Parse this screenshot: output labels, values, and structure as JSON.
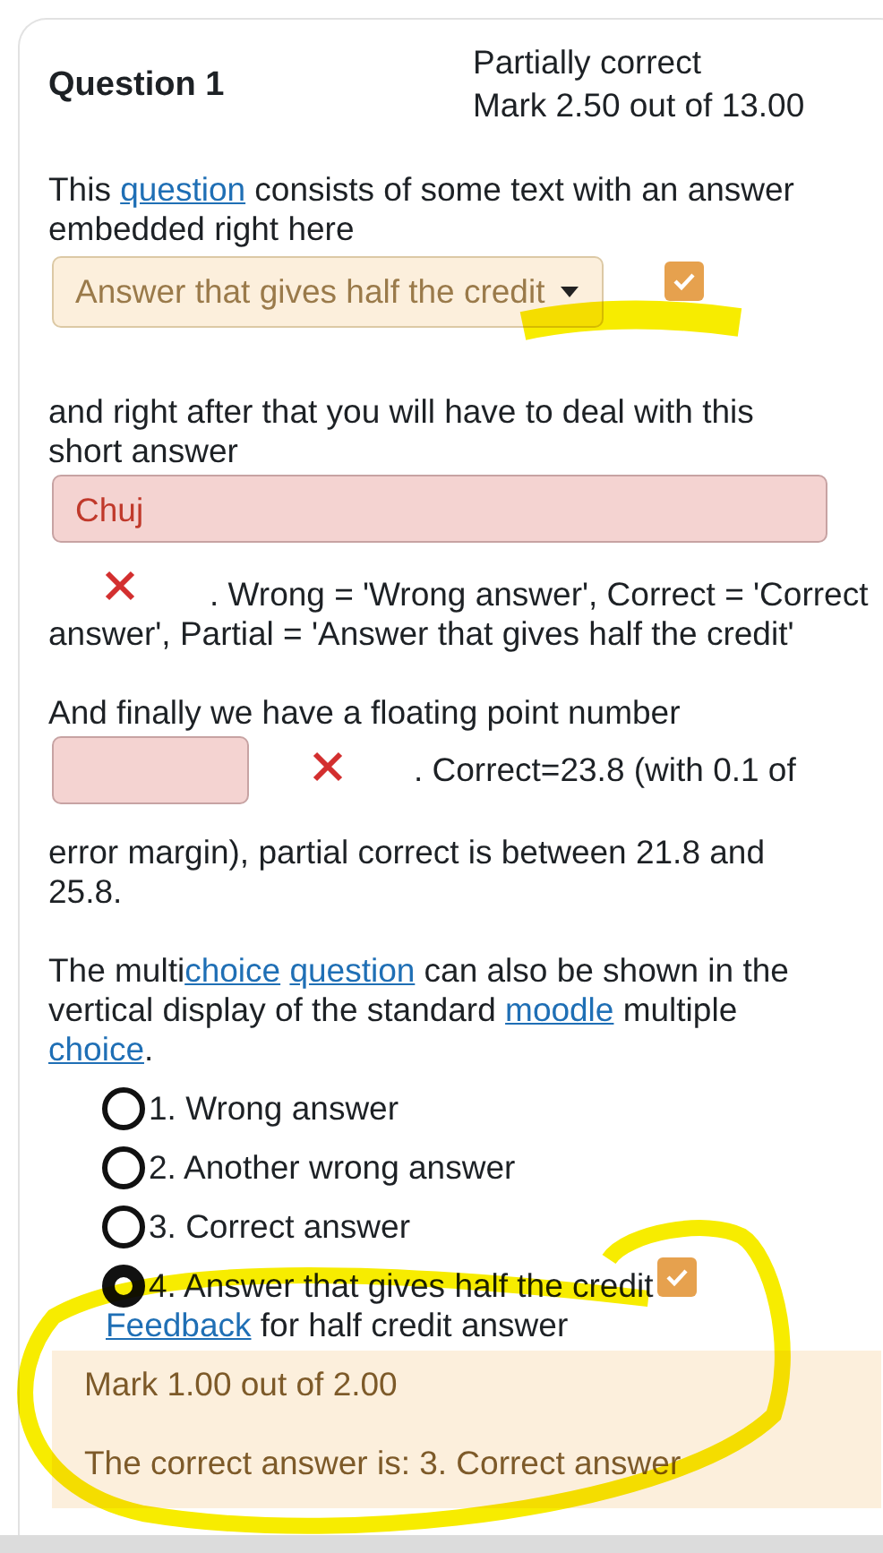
{
  "question": {
    "title": "Question 1",
    "state": "Partially correct",
    "mark": "Mark 2.50 out of 13.00"
  },
  "intro": [
    {
      "kind": "text",
      "text": "This "
    },
    {
      "kind": "link",
      "text": "question"
    },
    {
      "kind": "text",
      "text": " consists of some text with an answer embedded right here"
    }
  ],
  "dropdown": {
    "value": "Answer that gives half the credit",
    "partially_correct": true
  },
  "short_intro": "and right after that you will have to deal with this short answer",
  "short_answer": {
    "value": "Chuj",
    "partially_correct": false
  },
  "short_feedback": [
    ". Wrong = 'Wrong answer', Correct = 'Correct",
    "answer', Partial = 'Answer that gives half the credit'"
  ],
  "numeric_intro": "And finally we have a floating point number",
  "numeric": {
    "partially_correct": false
  },
  "numeric_feedback": [
    ". Correct=23.8 (with 0.1 of",
    "error margin), partial correct is between 21.8 and 25.8."
  ],
  "mc_intro": [
    {
      "kind": "text",
      "text": "The multi"
    },
    {
      "kind": "link",
      "text": "choice"
    },
    {
      "kind": "link",
      "text": "question"
    },
    {
      "kind": "text",
      "text": " can also be shown in the vertical display of the standard "
    },
    {
      "kind": "link",
      "text": "moodle"
    },
    {
      "kind": "text",
      "text": " multiple "
    },
    {
      "kind": "link",
      "text": "choice"
    },
    {
      "kind": "text",
      "text": "."
    }
  ],
  "options": [
    {
      "label": "1. Wrong answer",
      "selected": false
    },
    {
      "label": "2. Another wrong answer",
      "selected": false
    },
    {
      "label": "3. Correct answer",
      "selected": false
    },
    {
      "label": "4. Answer that gives half the credit",
      "selected": true,
      "partially_correct": true
    }
  ],
  "feedback": [
    {
      "kind": "link",
      "text": "Feedback"
    },
    {
      "kind": "text",
      "text": " for half credit answer"
    }
  ],
  "outcome": {
    "mark": "Mark 1.00 out of 2.00",
    "right_answer": "The correct answer is: 3. Correct answer"
  }
}
